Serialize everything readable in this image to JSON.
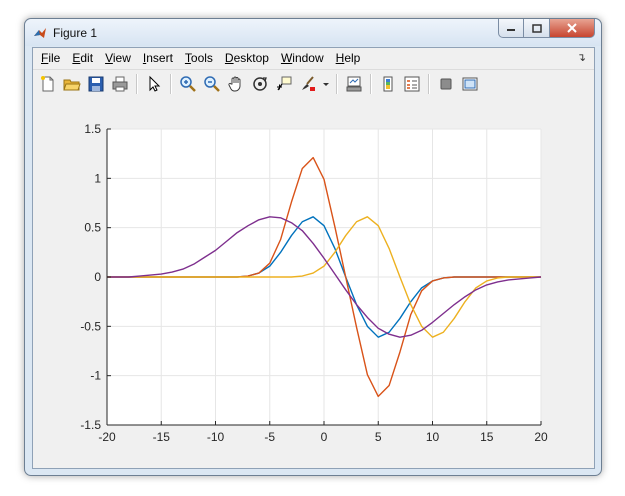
{
  "window": {
    "title": "Figure 1"
  },
  "menu": [
    {
      "u": "F",
      "rest": "ile"
    },
    {
      "u": "E",
      "rest": "dit"
    },
    {
      "u": "V",
      "rest": "iew"
    },
    {
      "u": "I",
      "rest": "nsert"
    },
    {
      "u": "T",
      "rest": "ools"
    },
    {
      "u": "D",
      "rest": "esktop"
    },
    {
      "u": "W",
      "rest": "indow"
    },
    {
      "u": "H",
      "rest": "elp"
    }
  ],
  "toolbar_icons": [
    "new-figure-icon",
    "open-file-icon",
    "save-icon",
    "print-icon",
    "select-arrow-icon",
    "zoom-in-icon",
    "zoom-out-icon",
    "pan-hand-icon",
    "rotate-3d-icon",
    "data-cursor-icon",
    "brush-icon",
    "brush-dropdown-icon",
    "link-plot-icon",
    "colorbar-icon",
    "legend-icon",
    "hide-plot-tools-icon",
    "show-plot-tools-icon"
  ],
  "chart_data": {
    "type": "line",
    "title": "",
    "xlabel": "",
    "ylabel": "",
    "xlim": [
      -20,
      20
    ],
    "ylim": [
      -1.5,
      1.5
    ],
    "xticks": [
      "-20",
      "-15",
      "-10",
      "-5",
      "0",
      "5",
      "10",
      "15",
      "20"
    ],
    "yticks": [
      "-1.5",
      "-1",
      "-0.5",
      "0",
      "0.5",
      "1",
      "1.5"
    ],
    "grid": true,
    "x": [
      -20,
      -19,
      -18,
      -17,
      -16,
      -15,
      -14,
      -13,
      -12,
      -11,
      -10,
      -9,
      -8,
      -7,
      -6,
      -5,
      -4,
      -3,
      -2,
      -1,
      0,
      1,
      2,
      3,
      4,
      5,
      6,
      7,
      8,
      9,
      10,
      11,
      12,
      13,
      14,
      15,
      16,
      17,
      18,
      19,
      20
    ],
    "series": [
      {
        "color": "#0072bd",
        "values": [
          0,
          0,
          0,
          0,
          0,
          0,
          0,
          0,
          0,
          0,
          0,
          0,
          0,
          0.01,
          0.04,
          0.11,
          0.25,
          0.42,
          0.56,
          0.61,
          0.52,
          0.29,
          0,
          -0.28,
          -0.5,
          -0.61,
          -0.56,
          -0.42,
          -0.25,
          -0.11,
          -0.04,
          -0.01,
          0,
          0,
          0,
          0,
          0,
          0,
          0,
          0,
          0
        ]
      },
      {
        "color": "#d95319",
        "values": [
          0,
          0,
          0,
          0,
          0,
          0,
          0,
          0,
          0,
          0,
          0,
          0,
          0,
          0.01,
          0.04,
          0.14,
          0.38,
          0.76,
          1.1,
          1.21,
          0.99,
          0.51,
          0,
          -0.51,
          -0.99,
          -1.21,
          -1.1,
          -0.76,
          -0.38,
          -0.14,
          -0.04,
          -0.01,
          0,
          0,
          0,
          0,
          0,
          0,
          0,
          0,
          0
        ]
      },
      {
        "color": "#edb120",
        "values": [
          0,
          0,
          0,
          0,
          0,
          0,
          0,
          0,
          0,
          0,
          0,
          0,
          0,
          0,
          0,
          0,
          0,
          0,
          0.01,
          0.04,
          0.11,
          0.25,
          0.42,
          0.56,
          0.61,
          0.52,
          0.29,
          0,
          -0.28,
          -0.5,
          -0.61,
          -0.56,
          -0.42,
          -0.25,
          -0.11,
          -0.04,
          -0.01,
          0,
          0,
          0,
          0
        ]
      },
      {
        "color": "#7e2f8e",
        "values": [
          0,
          0,
          0,
          0.01,
          0.02,
          0.03,
          0.05,
          0.08,
          0.13,
          0.2,
          0.27,
          0.36,
          0.45,
          0.52,
          0.58,
          0.61,
          0.6,
          0.55,
          0.47,
          0.34,
          0.19,
          0.03,
          -0.13,
          -0.28,
          -0.41,
          -0.52,
          -0.58,
          -0.61,
          -0.59,
          -0.54,
          -0.46,
          -0.37,
          -0.28,
          -0.2,
          -0.13,
          -0.08,
          -0.05,
          -0.03,
          -0.02,
          -0.01,
          0
        ]
      }
    ]
  }
}
